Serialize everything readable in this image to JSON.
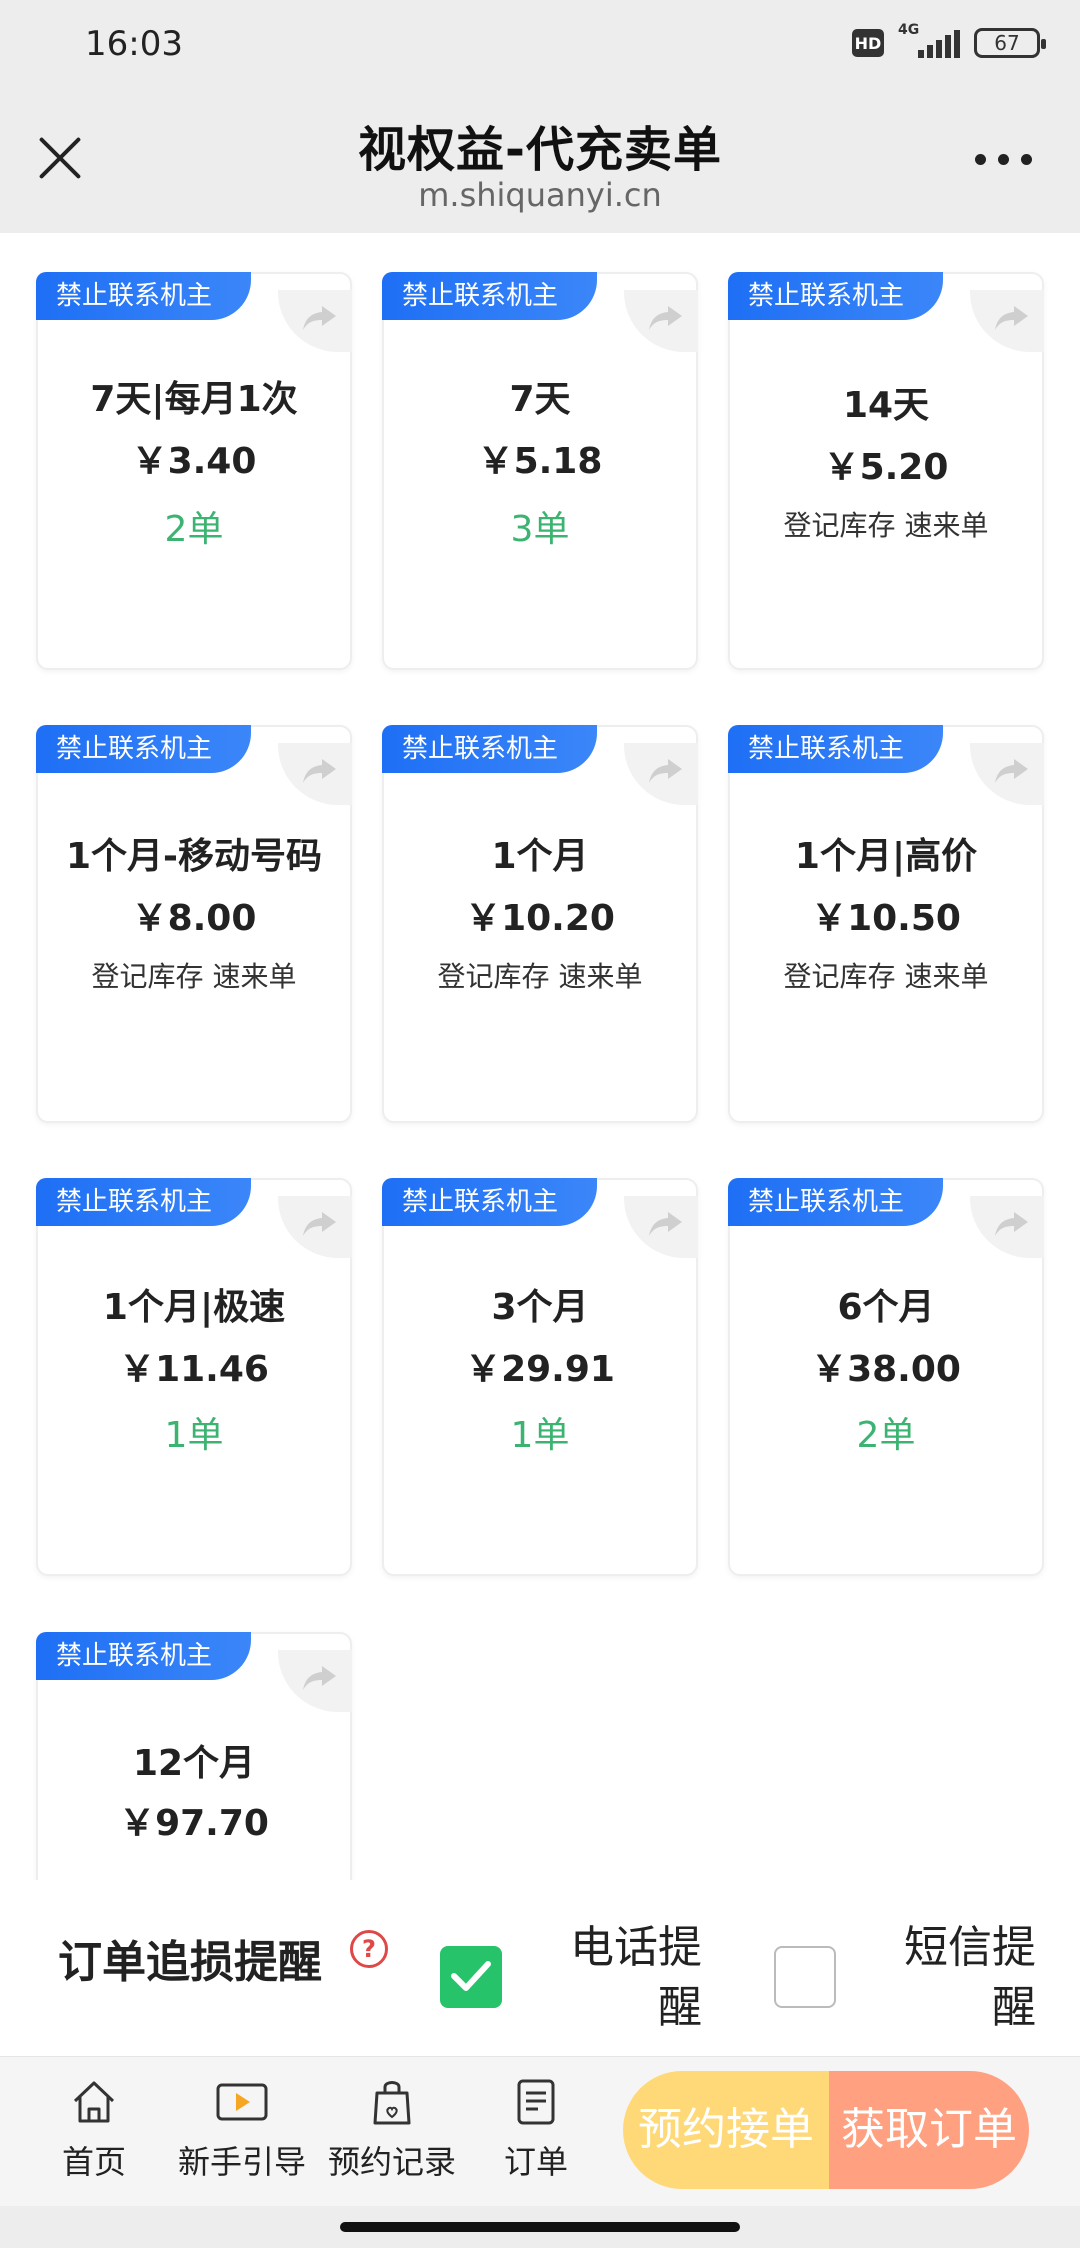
{
  "status_bar": {
    "time": "16:03",
    "hd": "HD",
    "network": "4G",
    "battery": "67"
  },
  "header": {
    "title": "视权益-代充卖单",
    "url": "m.shiquanyi.cn"
  },
  "products": [
    {
      "tag": "禁止联系机主",
      "name": "7天|每月1次",
      "price": "￥3.40",
      "stock": "2单",
      "stock_type": "orders"
    },
    {
      "tag": "禁止联系机主",
      "name": "7天",
      "price": "￥5.18",
      "stock": "3单",
      "stock_type": "orders"
    },
    {
      "tag": "禁止联系机主",
      "name": "14天",
      "price": "￥5.20",
      "stock": "登记库存 速来单",
      "stock_type": "note"
    },
    {
      "tag": "禁止联系机主",
      "name": "1个月-移动号码",
      "price": "￥8.00",
      "stock": "登记库存 速来单",
      "stock_type": "note"
    },
    {
      "tag": "禁止联系机主",
      "name": "1个月",
      "price": "￥10.20",
      "stock": "登记库存 速来单",
      "stock_type": "note"
    },
    {
      "tag": "禁止联系机主",
      "name": "1个月|高价",
      "price": "￥10.50",
      "stock": "登记库存 速来单",
      "stock_type": "note"
    },
    {
      "tag": "禁止联系机主",
      "name": "1个月|极速",
      "price": "￥11.46",
      "stock": "1单",
      "stock_type": "orders"
    },
    {
      "tag": "禁止联系机主",
      "name": "3个月",
      "price": "￥29.91",
      "stock": "1单",
      "stock_type": "orders"
    },
    {
      "tag": "禁止联系机主",
      "name": "6个月",
      "price": "￥38.00",
      "stock": "2单",
      "stock_type": "orders"
    },
    {
      "tag": "禁止联系机主",
      "name": "12个月",
      "price": "￥97.70",
      "stock": "",
      "stock_type": "none"
    }
  ],
  "reminder": {
    "title": "订单追损提醒",
    "help": "?",
    "phone_line1": "电话提",
    "phone_line2": "醒",
    "phone_checked": true,
    "sms_line1": "短信提",
    "sms_line2": "醒",
    "sms_checked": false
  },
  "bottom_nav": {
    "items": [
      {
        "label": "首页",
        "icon": "home-icon"
      },
      {
        "label": "新手引导",
        "icon": "video-guide-icon"
      },
      {
        "label": "预约记录",
        "icon": "shopping-bag-icon"
      },
      {
        "label": "订单",
        "icon": "order-list-icon"
      }
    ],
    "reserve_button": "预约接单",
    "get_button": "获取订单"
  },
  "colors": {
    "tag_blue": "#1e6ff5",
    "stock_green": "#3cb371",
    "check_green": "#27c36a",
    "reserve_yellow": "#ffd978",
    "get_orange": "#ffa080"
  }
}
